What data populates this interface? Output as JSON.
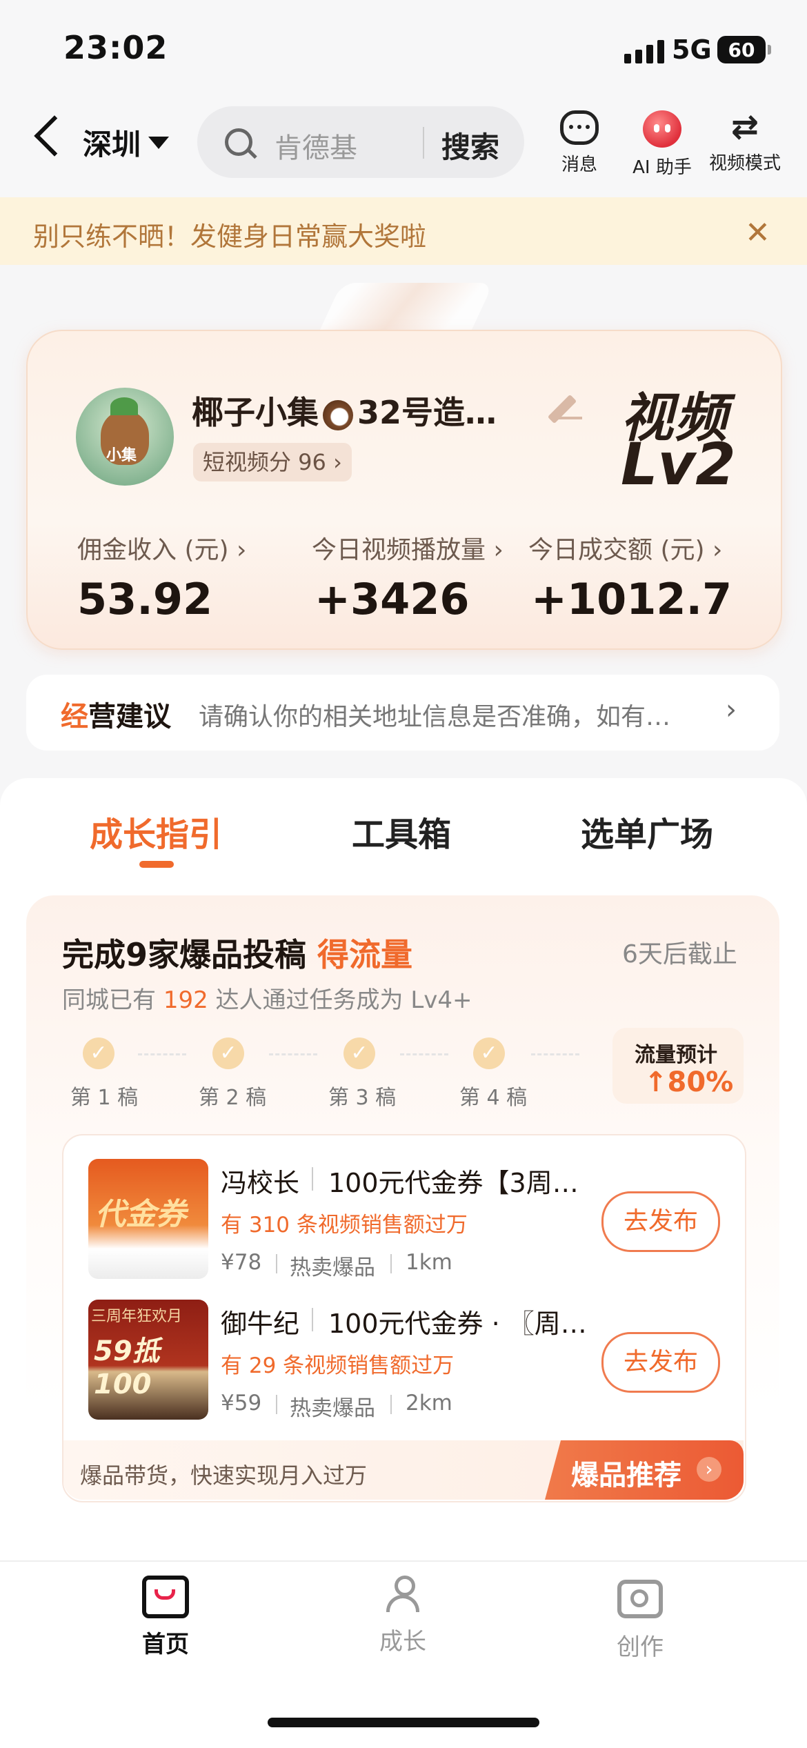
{
  "status": {
    "time": "23:02",
    "network": "5G",
    "battery": "60"
  },
  "nav": {
    "city": "深圳",
    "search_placeholder": "肯德基",
    "search_button": "搜索",
    "icons": [
      {
        "icon": "message-icon",
        "label": "消息"
      },
      {
        "icon": "ai-assistant-icon",
        "label": "AI 助手"
      },
      {
        "icon": "swap-icon",
        "label": "视频模式"
      }
    ]
  },
  "banner": {
    "text": "别只练不晒！发健身日常赢大奖啦",
    "close": "✕"
  },
  "profile": {
    "avatar_tag": "小集",
    "name": "椰子小集",
    "name_suffix": "32号造…",
    "score": "短视频分 96 ›",
    "level_line1": "视频",
    "level_line2": "Lv2",
    "stats": [
      {
        "label": "佣金收入 (元) ›",
        "value": "53.92"
      },
      {
        "label": "今日视频播放量 ›",
        "value": "+3426"
      },
      {
        "label": "今日成交额 (元) ›",
        "value": "+1012.7"
      }
    ]
  },
  "advice": {
    "title_first": "经",
    "title_rest": "营建议",
    "text": "请确认你的相关地址信息是否准确，如有…",
    "arrow": "›"
  },
  "tabs": [
    {
      "label": "成长指引",
      "active": true
    },
    {
      "label": "工具箱",
      "active": false
    },
    {
      "label": "选单广场",
      "active": false
    }
  ],
  "task": {
    "title": "完成9家爆品投稿",
    "title_highlight": "得流量",
    "deadline": "6天后截止",
    "sub_prefix": "同城已有",
    "sub_number": "192",
    "sub_suffix": "达人通过任务成为 Lv4+",
    "steps": [
      "第 1 稿",
      "第 2 稿",
      "第 3 稿",
      "第 4 稿"
    ],
    "check": "✓",
    "flow_label": "流量预计",
    "flow_value": "↑80%"
  },
  "products": [
    {
      "store": "冯校长",
      "title": "100元代金券【3周…",
      "sales": "有 310 条视频销售额过万",
      "price": "¥78",
      "tag": "热卖爆品",
      "distance": "1km",
      "thumb_text": "代金券",
      "button": "去发布"
    },
    {
      "store": "御牛纪",
      "title": "100元代金券 · 〖周…",
      "sales": "有 29 条视频销售额过万",
      "price": "¥59",
      "tag": "热卖爆品",
      "distance": "2km",
      "thumb_text": "三周年狂欢月",
      "thumb_text2": "59抵100",
      "button": "去发布"
    }
  ],
  "promo": {
    "text": "爆品带货，快速实现月入过万",
    "button": "爆品推荐",
    "arrow": "›"
  },
  "bottom_nav": [
    {
      "label": "首页",
      "icon": "home-bag-icon",
      "active": true
    },
    {
      "label": "成长",
      "icon": "growth-icon",
      "active": false
    },
    {
      "label": "创作",
      "icon": "camera-icon",
      "active": false
    }
  ],
  "colors": {
    "accent": "#f06a2c",
    "banner_bg": "#fdf3dc",
    "banner_text": "#b1763a"
  }
}
